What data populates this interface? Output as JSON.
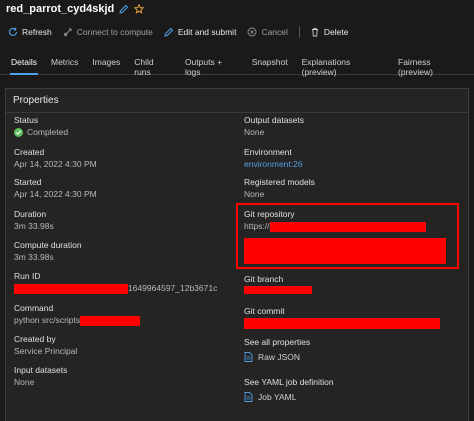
{
  "header": {
    "title": "red_parrot_cyd4skjd"
  },
  "toolbar": {
    "refresh": "Refresh",
    "connect": "Connect to compute",
    "edit": "Edit and submit",
    "cancel": "Cancel",
    "delete": "Delete"
  },
  "tabs": [
    "Details",
    "Metrics",
    "Images",
    "Child runs",
    "Outputs + logs",
    "Snapshot",
    "Explanations (preview)",
    "Fairness (preview)"
  ],
  "properties": {
    "heading": "Properties",
    "status_label": "Status",
    "status_value": "Completed",
    "created_label": "Created",
    "created_value": "Apr 14, 2022 4:30 PM",
    "started_label": "Started",
    "started_value": "Apr 14, 2022 4:30 PM",
    "duration_label": "Duration",
    "duration_value": "3m 33.98s",
    "compute_duration_label": "Compute duration",
    "compute_duration_value": "3m 33.98s",
    "run_id_label": "Run ID",
    "run_id_suffix": "1649964597_12b3671c",
    "command_label": "Command",
    "command_prefix": "python src/scripts",
    "created_by_label": "Created by",
    "created_by_value": "Service Principal",
    "input_datasets_label": "Input datasets",
    "input_datasets_value": "None",
    "output_datasets_label": "Output datasets",
    "output_datasets_value": "None",
    "environment_label": "Environment",
    "environment_value": "environment:26",
    "registered_models_label": "Registered models",
    "registered_models_value": "None",
    "git_repo_label": "Git repository",
    "git_repo_prefix": "https://",
    "git_branch_label": "Git branch",
    "git_commit_label": "Git commit",
    "all_props_label": "See all properties",
    "raw_json": "Raw JSON",
    "yaml_label": "See YAML job definition",
    "job_yaml": "Job YAML"
  },
  "colors": {
    "accent": "#4aa0e8",
    "success": "#5ec05e",
    "redaction": "#ff0000"
  },
  "icons": [
    "pencil-icon",
    "star-icon",
    "refresh-icon",
    "connect-icon",
    "edit-icon",
    "cancel-icon",
    "delete-icon",
    "check-icon",
    "document-icon"
  ]
}
